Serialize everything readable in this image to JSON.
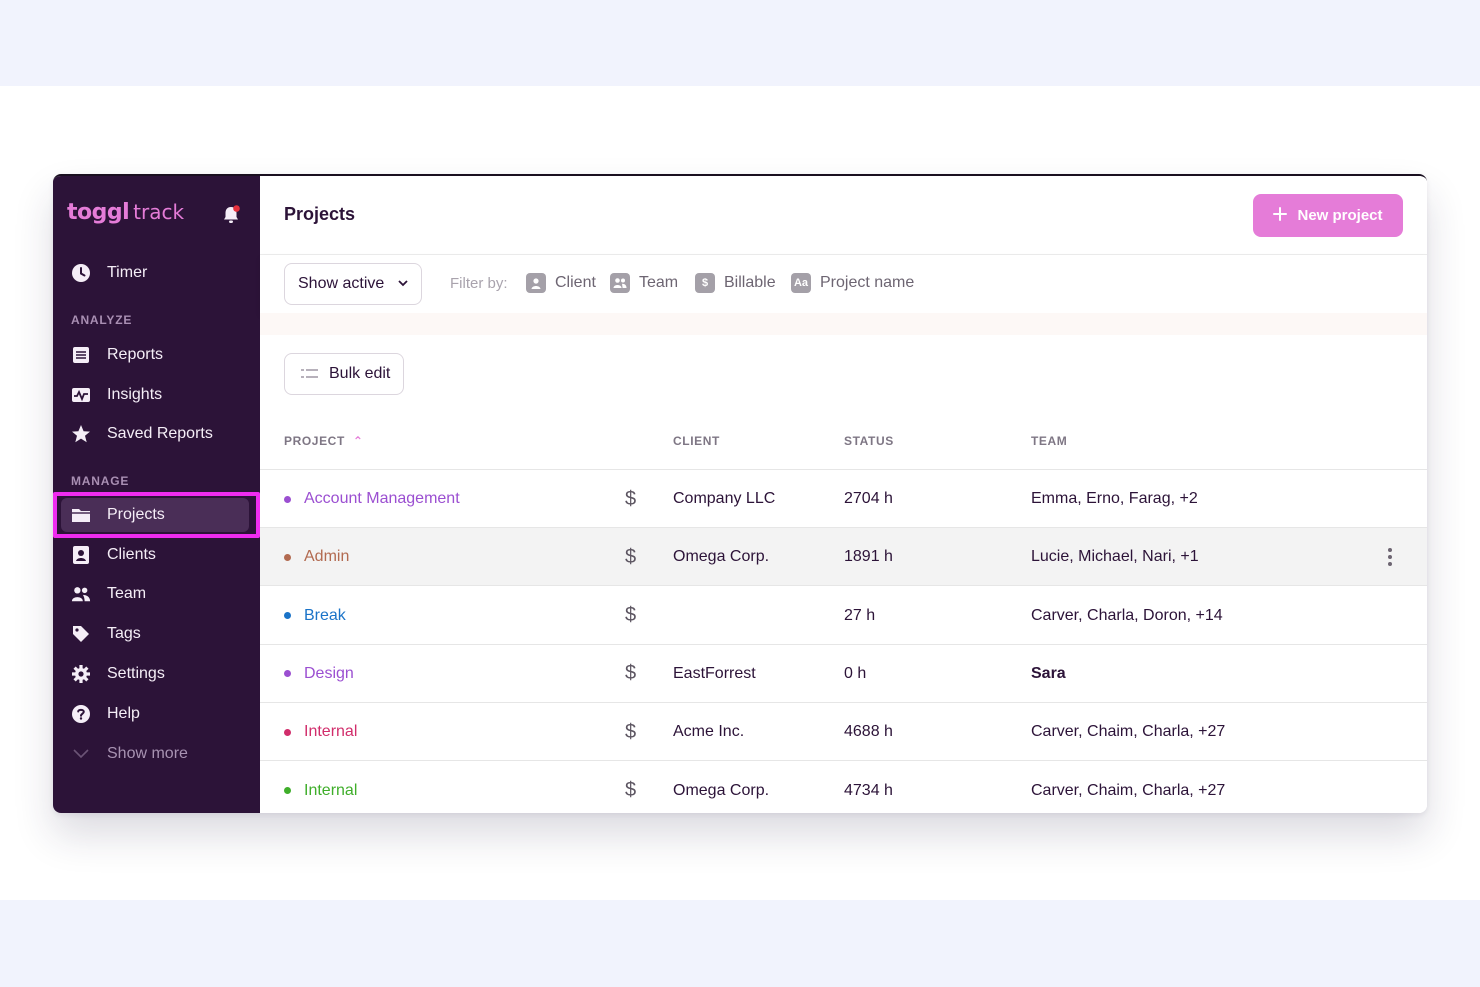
{
  "app": {
    "brand": "toggl",
    "product": "track"
  },
  "sidebar": {
    "timer": "Timer",
    "analyze_label": "ANALYZE",
    "analyze": [
      "Reports",
      "Insights",
      "Saved Reports"
    ],
    "manage_label": "MANAGE",
    "manage": [
      "Projects",
      "Clients",
      "Team",
      "Tags",
      "Settings",
      "Help"
    ],
    "show_more": "Show more",
    "active_item": "Projects"
  },
  "header": {
    "title": "Projects",
    "new_button": "New project"
  },
  "filters": {
    "status_select": "Show active",
    "label": "Filter by:",
    "items": [
      {
        "label": "Client",
        "icon": "client-icon"
      },
      {
        "label": "Team",
        "icon": "team-icon"
      },
      {
        "label": "Billable",
        "icon": "billable-icon"
      },
      {
        "label": "Project name",
        "icon": "project-name-icon",
        "glyph": "Aa"
      }
    ]
  },
  "bulk_edit": "Bulk edit",
  "table": {
    "columns": [
      "PROJECT",
      "CLIENT",
      "STATUS",
      "TEAM"
    ],
    "rows": [
      {
        "project": "Account Management",
        "color": "#9b4fd1",
        "client": "Company LLC",
        "status": "2704 h",
        "team": "Emma, Erno, Farag, +2"
      },
      {
        "project": "Admin",
        "color": "#b26a50",
        "client": "Omega Corp.",
        "status": "1891 h",
        "team": "Lucie, Michael, Nari, +1"
      },
      {
        "project": "Break",
        "color": "#1a73c8",
        "client": "",
        "status": "27 h",
        "team": "Carver, Charla, Doron, +14"
      },
      {
        "project": "Design",
        "color": "#9b4fd1",
        "client": "EastForrest",
        "status": "0 h",
        "team": "Sara"
      },
      {
        "project": "Internal",
        "color": "#d12d6b",
        "client": "Acme Inc.",
        "status": "4688 h",
        "team": "Carver, Chaim, Charla, +27"
      },
      {
        "project": "Internal",
        "color": "#3fae2a",
        "client": "Omega Corp.",
        "status": "4734 h",
        "team": "Carver, Chaim, Charla, +27"
      }
    ]
  }
}
